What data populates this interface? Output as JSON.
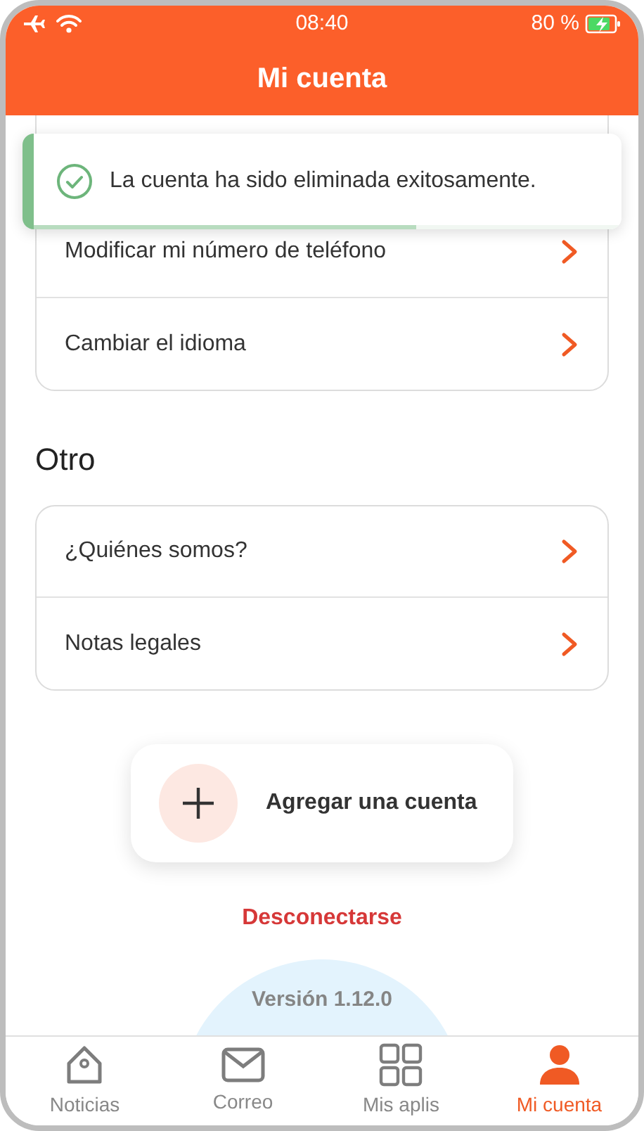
{
  "status_bar": {
    "time": "08:40",
    "battery": "80 %"
  },
  "header": {
    "title": "Mi cuenta"
  },
  "toast": {
    "message": "La cuenta ha sido eliminada exitosamente.",
    "level": 0.65
  },
  "account_items": [
    {
      "label": "Modificar mi número de teléfono"
    },
    {
      "label": "Cambiar el idioma"
    }
  ],
  "other_section": {
    "title": "Otro",
    "items": [
      {
        "label": "¿Quiénes somos?"
      },
      {
        "label": "Notas legales"
      }
    ]
  },
  "add_account": {
    "label": "Agregar una cuenta"
  },
  "logout": {
    "label": "Desconectarse"
  },
  "version": "Versión 1.12.0",
  "tabs": [
    {
      "label": "Noticias",
      "kind": "home",
      "selected": false
    },
    {
      "label": "Correo",
      "kind": "mail",
      "selected": false
    },
    {
      "label": "Mis aplis",
      "kind": "grid",
      "selected": false
    },
    {
      "label": "Mi cuenta",
      "kind": "user",
      "selected": true
    }
  ]
}
